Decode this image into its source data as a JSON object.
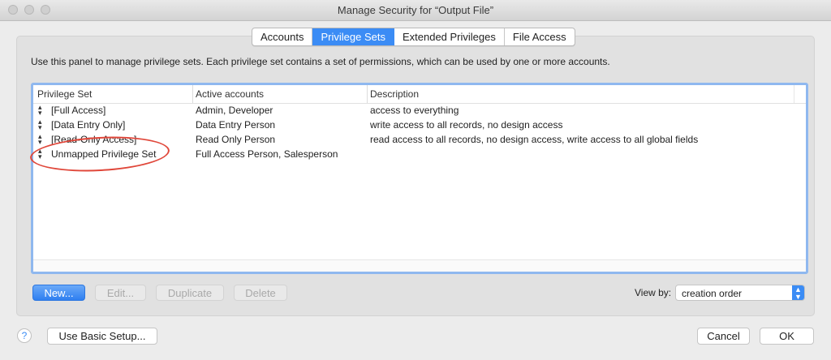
{
  "window": {
    "title": "Manage Security for “Output File”"
  },
  "tabs": [
    {
      "label": "Accounts",
      "active": false
    },
    {
      "label": "Privilege Sets",
      "active": true
    },
    {
      "label": "Extended Privileges",
      "active": false
    },
    {
      "label": "File Access",
      "active": false
    }
  ],
  "panel": {
    "description": "Use this panel to manage privilege sets.  Each privilege set contains a set of permissions, which can be used by one or more accounts."
  },
  "table": {
    "headers": [
      "Privilege Set",
      "Active accounts",
      "Description"
    ],
    "rows": [
      {
        "name": "[Full Access]",
        "accounts": "Admin, Developer",
        "description": "access to everything"
      },
      {
        "name": "[Data Entry Only]",
        "accounts": "Data Entry Person",
        "description": "write access to all records, no design access"
      },
      {
        "name": "[Read-Only Access]",
        "accounts": "Read Only Person",
        "description": "read access to all records, no design access, write access to all global fields"
      },
      {
        "name": "Unmapped Privilege Set",
        "accounts": "Full Access Person, Salesperson",
        "description": ""
      }
    ],
    "sort_icon": "updown-arrows-icon"
  },
  "buttons": {
    "new": "New...",
    "edit": "Edit...",
    "duplicate": "Duplicate",
    "delete": "Delete",
    "basic_setup": "Use Basic Setup...",
    "cancel": "Cancel",
    "ok": "OK",
    "help": "?"
  },
  "view_by": {
    "label": "View by:",
    "value": "creation order"
  },
  "colors": {
    "accent": "#3b8cf5",
    "highlight_oval": "#e0473a"
  }
}
